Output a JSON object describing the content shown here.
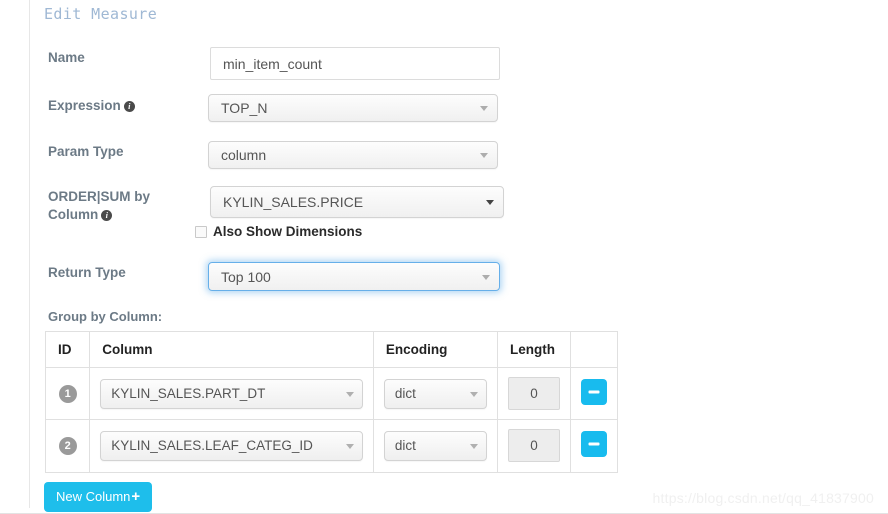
{
  "dialog": {
    "title": "Edit Measure"
  },
  "form": {
    "name": {
      "label": "Name",
      "value": "min_item_count",
      "placeholder": ""
    },
    "expression": {
      "label": "Expression",
      "value": "TOP_N",
      "info_icon": "info-icon"
    },
    "param_type": {
      "label": "Param Type",
      "value": "column"
    },
    "order_sum_by_column": {
      "label_line1": "ORDER|SUM by",
      "label_line2": "Column",
      "value": "KYLIN_SALES.PRICE",
      "info_icon": "info-icon"
    },
    "also_show_dimensions": {
      "label": "Also Show Dimensions",
      "checked": false
    },
    "return_type": {
      "label": "Return Type",
      "value": "Top 100",
      "focused": true
    }
  },
  "group_by": {
    "section_label": "Group by Column:",
    "columns": [
      "ID",
      "Column",
      "Encoding",
      "Length",
      ""
    ],
    "rows": [
      {
        "id": "1",
        "column": "KYLIN_SALES.PART_DT",
        "encoding": "dict",
        "length": "0",
        "remove_icon": "minus-icon"
      },
      {
        "id": "2",
        "column": "KYLIN_SALES.LEAF_CATEG_ID",
        "encoding": "dict",
        "length": "0",
        "remove_icon": "minus-icon"
      }
    ],
    "new_column_button": {
      "label": "New Column",
      "plus": "+"
    }
  },
  "watermark": "https://blog.csdn.net/qq_41837900",
  "colors": {
    "title": "#9fb8d4",
    "accent": "#1ebeeb",
    "label": "#6c7a86",
    "focus_ring": "#66afe9"
  }
}
